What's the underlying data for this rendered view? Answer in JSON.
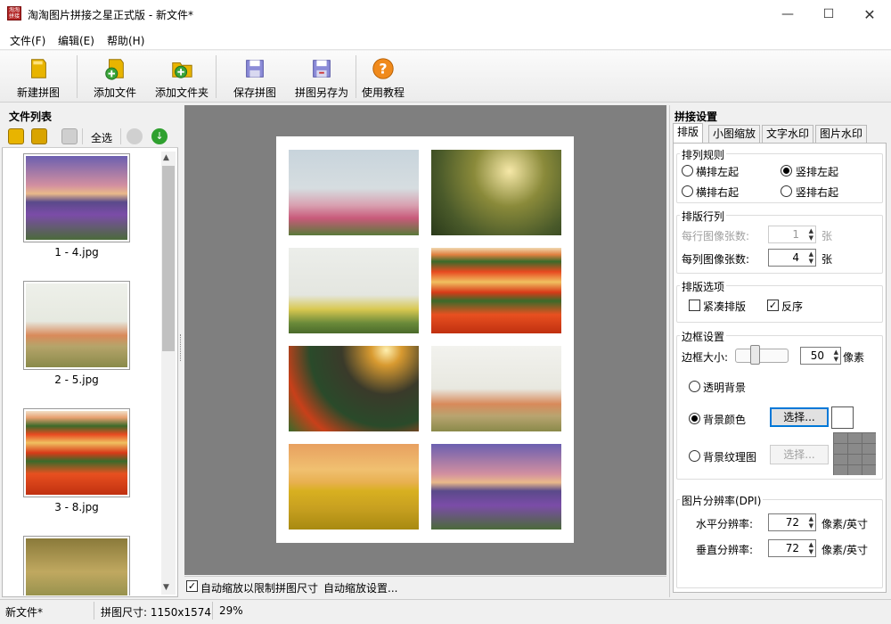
{
  "window": {
    "title": "淘淘图片拼接之星正式版 - 新文件*",
    "icon_text": "淘淘拼接"
  },
  "menu": [
    "文件(F)",
    "编辑(E)",
    "帮助(H)"
  ],
  "toolbar": [
    {
      "label": "新建拼图",
      "icon": "new-icon"
    },
    {
      "label": "添加文件",
      "icon": "add-file-icon"
    },
    {
      "label": "添加文件夹",
      "icon": "add-folder-icon"
    },
    {
      "label": "保存拼图",
      "icon": "save-icon"
    },
    {
      "label": "拼图另存为",
      "icon": "save-as-icon"
    },
    {
      "label": "使用教程",
      "icon": "help-icon"
    }
  ],
  "file_panel": {
    "title": "文件列表",
    "select_all": "全选",
    "files": [
      {
        "name": "1 - 4.jpg",
        "image": "purple-lake"
      },
      {
        "name": "2 - 5.jpg",
        "image": "pale-field"
      },
      {
        "name": "3 - 8.jpg",
        "image": "tulip-rows"
      },
      {
        "name": "",
        "image": "daisy-field"
      }
    ]
  },
  "canvas": {
    "auto_zoom_label": "自动缩放以限制拼图尺寸",
    "auto_zoom_checked": true,
    "auto_zoom_settings": "自动缩放设置..."
  },
  "settings": {
    "title": "拼接设置",
    "tabs": [
      "排版",
      "小图缩放",
      "文字水印",
      "图片水印"
    ],
    "active_tab": "排版",
    "order": {
      "title": "排列规则",
      "options": [
        "横排左起",
        "竖排左起",
        "横排右起",
        "竖排右起"
      ],
      "selected": "竖排左起"
    },
    "grid": {
      "title": "排版行列",
      "per_row_label": "每行图像张数:",
      "per_row_value": "1",
      "per_col_label": "每列图像张数:",
      "per_col_value": "4",
      "unit": "张"
    },
    "options": {
      "title": "排版选项",
      "compact_label": "紧凑排版",
      "compact_checked": false,
      "reverse_label": "反序",
      "reverse_checked": true
    },
    "border": {
      "title": "边框设置",
      "size_label": "边框大小:",
      "size_value": "50",
      "size_unit": "像素",
      "transparent_label": "透明背景",
      "color_label": "背景颜色",
      "texture_label": "背景纹理图",
      "selected": "背景颜色",
      "choose_label": "选择...",
      "bg_color": "#ffffff"
    },
    "dpi": {
      "title": "图片分辨率(DPI)",
      "h_label": "水平分辨率:",
      "h_value": "72",
      "v_label": "垂直分辨率:",
      "v_value": "72",
      "unit": "像素/英寸"
    }
  },
  "status": {
    "file": "新文件*",
    "size": "拼图尺寸: 1150x1574",
    "zoom": "29%"
  }
}
